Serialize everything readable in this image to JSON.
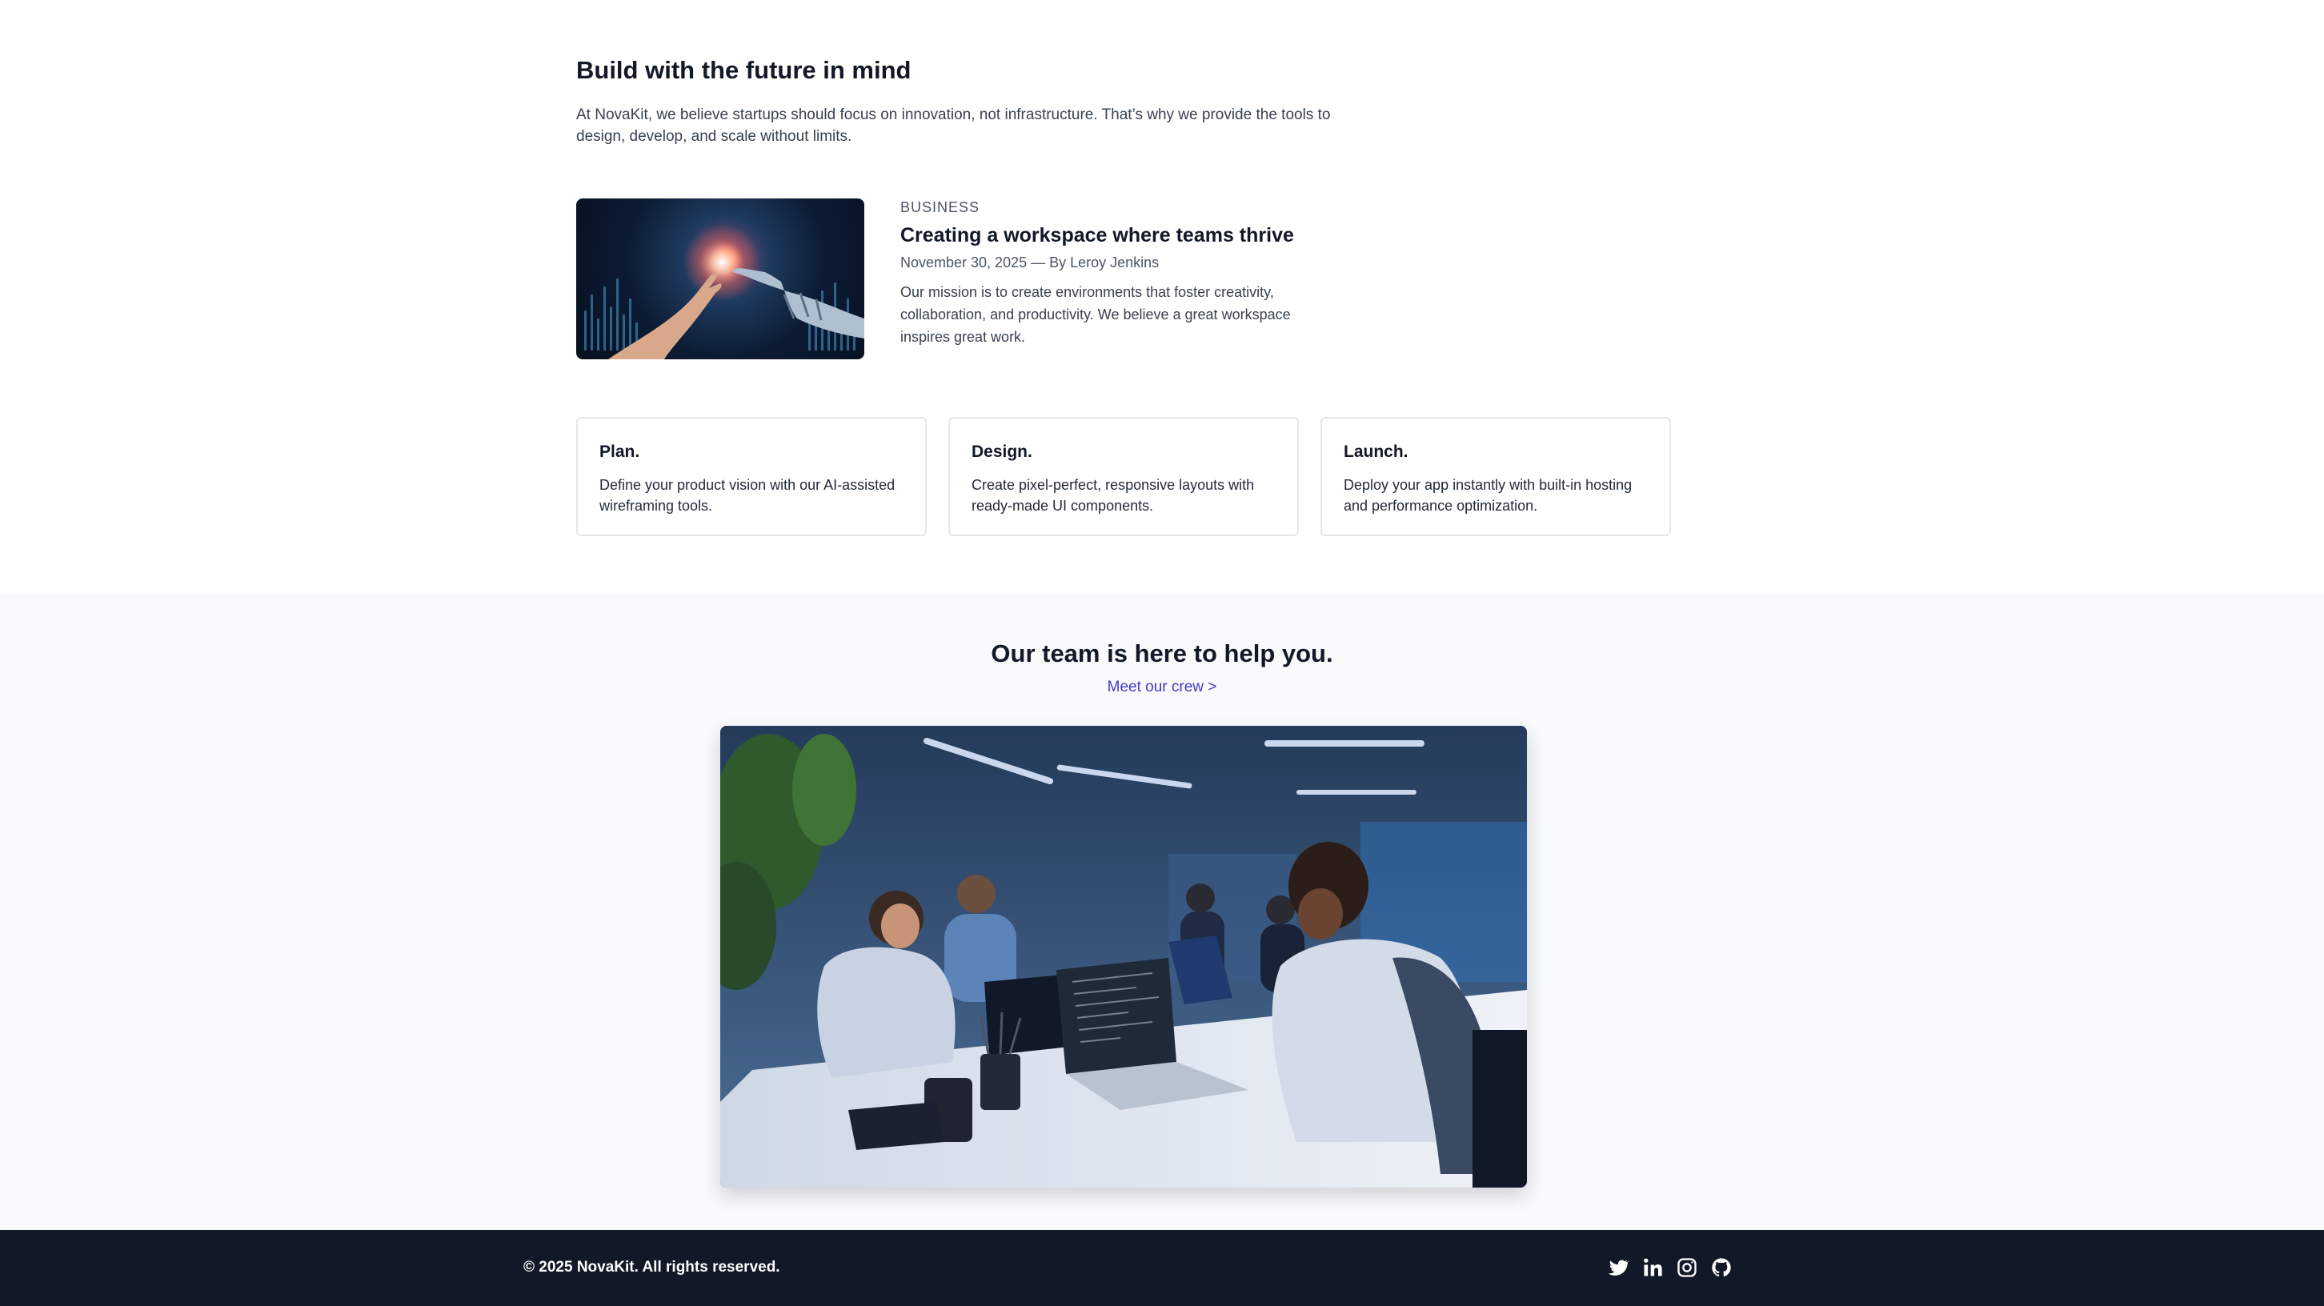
{
  "intro": {
    "heading": "Build with the future in mind",
    "description_line1": "At NovaKit, we believe startups should focus on innovation, not infrastructure. That’s why we provide the tools to",
    "description_line2": "design, develop, and scale without limits."
  },
  "article": {
    "category": "BUSINESS",
    "title": "Creating a workspace where teams thrive",
    "meta": "November 30, 2025 — By Leroy Jenkins",
    "excerpt": "Our mission is to create environments that foster creativity, collaboration, and productivity. We believe a great workspace inspires great work."
  },
  "features": [
    {
      "title": "Plan.",
      "text": "Define your product vision with our AI-assisted wireframing tools."
    },
    {
      "title": "Design.",
      "text": "Create pixel-perfect, responsive layouts with ready-made UI components."
    },
    {
      "title": "Launch.",
      "text": "Deploy your app instantly with built-in hosting and performance optimization."
    }
  ],
  "team": {
    "heading": "Our team is here to help you.",
    "link": "Meet our crew >"
  },
  "footer": {
    "copyright": "© 2025 NovaKit. All rights reserved.",
    "socials": [
      "twitter-icon",
      "linkedin-icon",
      "instagram-icon",
      "github-icon"
    ]
  },
  "colors": {
    "text_primary": "#111827",
    "text_secondary": "#374151",
    "link": "#4338ca",
    "section_bg": "#f8fafc",
    "footer_bg": "#111827",
    "card_border": "#e5e7eb"
  }
}
